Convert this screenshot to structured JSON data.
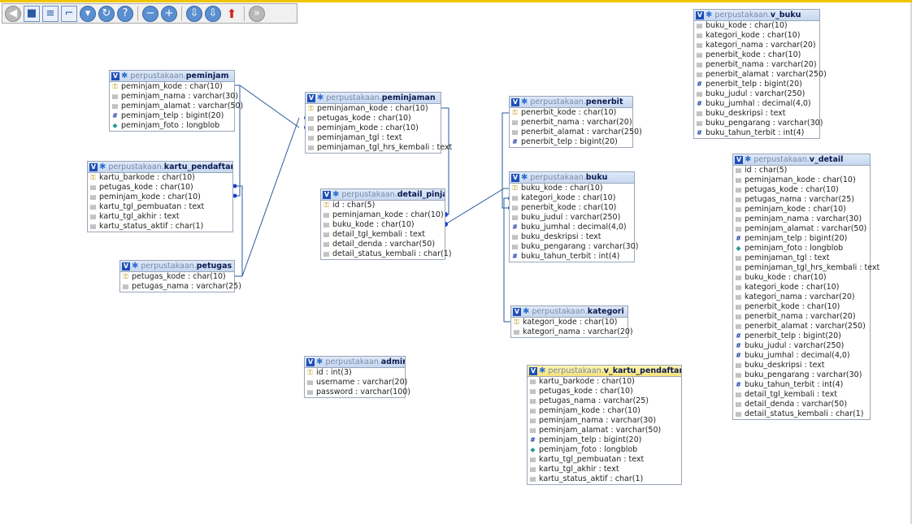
{
  "toolbar": {
    "buttons": [
      {
        "name": "back-icon",
        "glyph": "◀",
        "style": "grey"
      },
      {
        "name": "save-icon",
        "glyph": "■",
        "style": "square"
      },
      {
        "name": "list-icon",
        "glyph": "≡",
        "style": "square"
      },
      {
        "name": "relation-icon",
        "glyph": "⌐",
        "style": "square"
      },
      {
        "name": "arrow-down-icon",
        "glyph": "▾",
        "style": "circle"
      },
      {
        "name": "refresh-icon",
        "glyph": "↻",
        "style": "circle"
      },
      {
        "name": "help-icon",
        "glyph": "?",
        "style": "circle"
      },
      {
        "name": "sep"
      },
      {
        "name": "zoom-out-icon",
        "glyph": "−",
        "style": "circle"
      },
      {
        "name": "zoom-in-icon",
        "glyph": "+",
        "style": "circle"
      },
      {
        "name": "sep"
      },
      {
        "name": "export-icon",
        "glyph": "⇩",
        "style": "circle"
      },
      {
        "name": "import-icon",
        "glyph": "⇩",
        "style": "circle"
      },
      {
        "name": "pdf-icon",
        "glyph": "⬆",
        "style": "pdf"
      },
      {
        "name": "sep"
      },
      {
        "name": "forward-icon",
        "glyph": "»",
        "style": "grey"
      }
    ]
  },
  "schema": "perpustakaan.",
  "tables": [
    {
      "id": "peminjam",
      "name": "peminjam",
      "view": false,
      "columns": [
        [
          "key",
          "peminjam_kode : char(10)"
        ],
        [
          "text",
          "peminjam_nama : varchar(30)"
        ],
        [
          "text",
          "peminjam_alamat : varchar(50)"
        ],
        [
          "num",
          "peminjam_telp : bigint(20)"
        ],
        [
          "blob",
          "peminjam_foto : longblob"
        ]
      ]
    },
    {
      "id": "kartu_pendaftaran",
      "name": "kartu_pendaftaran",
      "view": false,
      "columns": [
        [
          "key",
          "kartu_barkode : char(10)"
        ],
        [
          "text",
          "petugas_kode : char(10)"
        ],
        [
          "text",
          "peminjam_kode : char(10)"
        ],
        [
          "text",
          "kartu_tgl_pembuatan : text"
        ],
        [
          "text",
          "kartu_tgl_akhir : text"
        ],
        [
          "text",
          "kartu_status_aktif : char(1)"
        ]
      ]
    },
    {
      "id": "petugas",
      "name": "petugas",
      "view": false,
      "columns": [
        [
          "key",
          "petugas_kode : char(10)"
        ],
        [
          "text",
          "petugas_nama : varchar(25)"
        ]
      ]
    },
    {
      "id": "peminjaman",
      "name": "peminjaman",
      "view": false,
      "columns": [
        [
          "key",
          "peminjaman_kode : char(10)"
        ],
        [
          "text",
          "petugas_kode : char(10)"
        ],
        [
          "text",
          "peminjam_kode : char(10)"
        ],
        [
          "text",
          "peminjaman_tgl : text"
        ],
        [
          "text",
          "peminjaman_tgl_hrs_kembali : text"
        ]
      ]
    },
    {
      "id": "detail_pinjam",
      "name": "detail_pinjam",
      "view": false,
      "columns": [
        [
          "key",
          "id : char(5)"
        ],
        [
          "text",
          "peminjaman_kode : char(10)"
        ],
        [
          "text",
          "buku_kode : char(10)"
        ],
        [
          "text",
          "detail_tgl_kembali : text"
        ],
        [
          "text",
          "detail_denda : varchar(50)"
        ],
        [
          "text",
          "detail_status_kembali : char(1)"
        ]
      ]
    },
    {
      "id": "admin",
      "name": "admin",
      "view": false,
      "columns": [
        [
          "key",
          "id : int(3)"
        ],
        [
          "text",
          "username : varchar(20)"
        ],
        [
          "text",
          "password : varchar(100)"
        ]
      ]
    },
    {
      "id": "penerbit",
      "name": "penerbit",
      "view": false,
      "columns": [
        [
          "key",
          "penerbit_kode : char(10)"
        ],
        [
          "text",
          "penerbit_nama : varchar(20)"
        ],
        [
          "text",
          "penerbit_alamat : varchar(250)"
        ],
        [
          "num",
          "penerbit_telp : bigint(20)"
        ]
      ]
    },
    {
      "id": "buku",
      "name": "buku",
      "view": false,
      "columns": [
        [
          "key",
          "buku_kode : char(10)"
        ],
        [
          "text",
          "kategori_kode : char(10)"
        ],
        [
          "text",
          "penerbit_kode : char(10)"
        ],
        [
          "text",
          "buku_judul : varchar(250)"
        ],
        [
          "num",
          "buku_jumhal : decimal(4,0)"
        ],
        [
          "text",
          "buku_deskripsi : text"
        ],
        [
          "text",
          "buku_pengarang : varchar(30)"
        ],
        [
          "num",
          "buku_tahun_terbit : int(4)"
        ]
      ]
    },
    {
      "id": "kategori",
      "name": "kategori",
      "view": false,
      "columns": [
        [
          "key",
          "kategori_kode : char(10)"
        ],
        [
          "text",
          "kategori_nama : varchar(20)"
        ]
      ]
    },
    {
      "id": "v_kartu_pendaftaran",
      "name": "v_kartu_pendaftaran",
      "view": true,
      "columns": [
        [
          "text",
          "kartu_barkode : char(10)"
        ],
        [
          "text",
          "petugas_kode : char(10)"
        ],
        [
          "text",
          "petugas_nama : varchar(25)"
        ],
        [
          "text",
          "peminjam_kode : char(10)"
        ],
        [
          "text",
          "peminjam_nama : varchar(30)"
        ],
        [
          "text",
          "peminjam_alamat : varchar(50)"
        ],
        [
          "num",
          "peminjam_telp : bigint(20)"
        ],
        [
          "blob",
          "peminjam_foto : longblob"
        ],
        [
          "text",
          "kartu_tgl_pembuatan : text"
        ],
        [
          "text",
          "kartu_tgl_akhir : text"
        ],
        [
          "text",
          "kartu_status_aktif : char(1)"
        ]
      ]
    },
    {
      "id": "v_buku",
      "name": "v_buku",
      "view": false,
      "columns": [
        [
          "text",
          "buku_kode : char(10)"
        ],
        [
          "text",
          "kategori_kode : char(10)"
        ],
        [
          "text",
          "kategori_nama : varchar(20)"
        ],
        [
          "text",
          "penerbit_kode : char(10)"
        ],
        [
          "text",
          "penerbit_nama : varchar(20)"
        ],
        [
          "text",
          "penerbit_alamat : varchar(250)"
        ],
        [
          "num",
          "penerbit_telp : bigint(20)"
        ],
        [
          "text",
          "buku_judul : varchar(250)"
        ],
        [
          "num",
          "buku_jumhal : decimal(4,0)"
        ],
        [
          "text",
          "buku_deskripsi : text"
        ],
        [
          "text",
          "buku_pengarang : varchar(30)"
        ],
        [
          "num",
          "buku_tahun_terbit : int(4)"
        ]
      ]
    },
    {
      "id": "v_detail",
      "name": "v_detail",
      "view": false,
      "columns": [
        [
          "text",
          "id : char(5)"
        ],
        [
          "text",
          "peminjaman_kode : char(10)"
        ],
        [
          "text",
          "petugas_kode : char(10)"
        ],
        [
          "text",
          "petugas_nama : varchar(25)"
        ],
        [
          "text",
          "peminjam_kode : char(10)"
        ],
        [
          "text",
          "peminjam_nama : varchar(30)"
        ],
        [
          "text",
          "peminjam_alamat : varchar(50)"
        ],
        [
          "num",
          "peminjam_telp : bigint(20)"
        ],
        [
          "blob",
          "peminjam_foto : longblob"
        ],
        [
          "text",
          "peminjaman_tgl : text"
        ],
        [
          "text",
          "peminjaman_tgl_hrs_kembali : text"
        ],
        [
          "text",
          "buku_kode : char(10)"
        ],
        [
          "text",
          "kategori_kode : char(10)"
        ],
        [
          "text",
          "kategori_nama : varchar(20)"
        ],
        [
          "text",
          "penerbit_kode : char(10)"
        ],
        [
          "text",
          "penerbit_nama : varchar(20)"
        ],
        [
          "text",
          "penerbit_alamat : varchar(250)"
        ],
        [
          "num",
          "penerbit_telp : bigint(20)"
        ],
        [
          "num",
          "buku_judul : varchar(250)"
        ],
        [
          "num",
          "buku_jumhal : decimal(4,0)"
        ],
        [
          "text",
          "buku_deskripsi : text"
        ],
        [
          "text",
          "buku_pengarang : varchar(30)"
        ],
        [
          "num",
          "buku_tahun_terbit : int(4)"
        ],
        [
          "text",
          "detail_tgl_kembali : text"
        ],
        [
          "text",
          "detail_denda : varchar(50)"
        ],
        [
          "text",
          "detail_status_kembali : char(1)"
        ]
      ]
    }
  ]
}
